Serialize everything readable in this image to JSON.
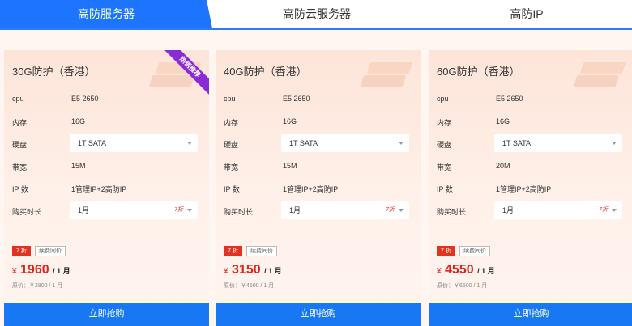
{
  "tabs": [
    {
      "label": "高防服务器",
      "active": true
    },
    {
      "label": "高防云服务器",
      "active": false
    },
    {
      "label": "高防IP",
      "active": false
    }
  ],
  "labels": {
    "cpu": "cpu",
    "memory": "内存",
    "disk": "硬盘",
    "bandwidth": "带宽",
    "ip": "IP 数",
    "duration": "购买时长",
    "renew": "续费同价",
    "buy": "立即抢购",
    "yen": "¥",
    "hot": "热销推荐"
  },
  "cards": [
    {
      "title": "30G防护（香港）",
      "cpu": "E5 2650",
      "memory": "16G",
      "disk": "1T SATA",
      "bandwidth": "15M",
      "ip": "1管理IP+2高防IP",
      "duration": "1月",
      "duration_discount": "7折",
      "discount_badge": "7 折",
      "price": "1960",
      "price_unit": "/ 1 月",
      "original": "原价：￥2800 / 1 月"
    },
    {
      "title": "40G防护（香港）",
      "cpu": "E5 2650",
      "memory": "16G",
      "disk": "1T SATA",
      "bandwidth": "15M",
      "ip": "1管理IP+2高防IP",
      "duration": "1月",
      "duration_discount": "7折",
      "discount_badge": "7 折",
      "price": "3150",
      "price_unit": "/ 1 月",
      "original": "原价：￥4500 / 1 月"
    },
    {
      "title": "60G防护（香港）",
      "cpu": "E5 2650",
      "memory": "16G",
      "disk": "1T SATA",
      "bandwidth": "20M",
      "ip": "1管理IP+2高防IP",
      "duration": "1月",
      "duration_discount": "7折",
      "discount_badge": "7 折",
      "price": "4550",
      "price_unit": "/ 1 月",
      "original": "原价：￥6500 / 1 月"
    }
  ],
  "colors": {
    "accent": "#1c74ff",
    "price": "#e0241b",
    "ribbon": "#8a2bd6"
  }
}
